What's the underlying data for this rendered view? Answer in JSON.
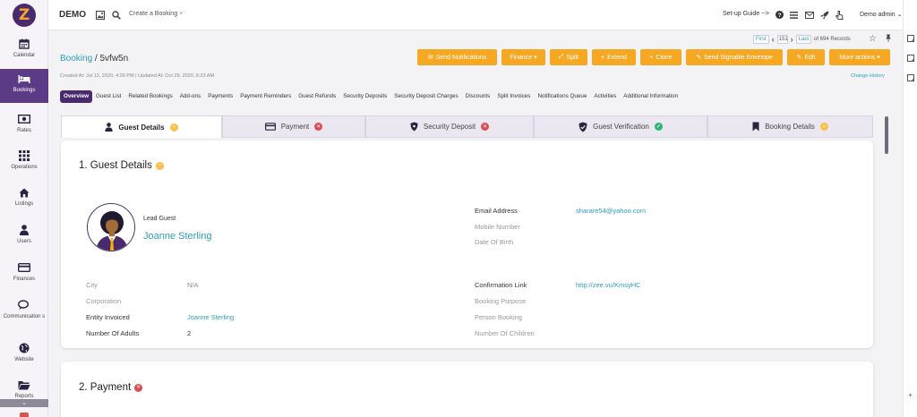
{
  "sidebar": {
    "logo": "Z",
    "items": [
      {
        "label": "Calendar",
        "icon": "calendar-icon"
      },
      {
        "label": "Bookings",
        "icon": "bed-icon"
      },
      {
        "label": "Rates",
        "icon": "money-icon"
      },
      {
        "label": "Operations",
        "icon": "grid-icon"
      },
      {
        "label": "Listings",
        "icon": "home-icon"
      },
      {
        "label": "Users",
        "icon": "user-icon"
      },
      {
        "label": "Finances",
        "icon": "credit-card-icon"
      },
      {
        "label": "Communication s",
        "icon": "chat-icon"
      },
      {
        "label": "Website",
        "icon": "globe-icon"
      },
      {
        "label": "Reports",
        "icon": "folder-icon"
      }
    ],
    "active": "Bookings",
    "scroll_glyph": "⌄"
  },
  "topbar": {
    "brand": "DEMO",
    "tab_label": "Create a Booking",
    "tab_close": "×",
    "setup_guide": "Set-up Guide -->",
    "user": "Demo admin",
    "user_caret": "⌄"
  },
  "pager": {
    "first": "First",
    "prev": "‹",
    "current": "151",
    "next": "›",
    "last": "Last",
    "total": "of 694 Records"
  },
  "breadcrumb": {
    "parent": "Booking",
    "separator": "/",
    "current": "5vfw5n"
  },
  "meta": "Created At: Jul 13, 2020, 4:06 PM  |  Updated At: Oct 29, 2020, 6:23 AM",
  "change_history": "Change History",
  "actions": [
    {
      "label": "Send Notifications",
      "icon": "✉"
    },
    {
      "label": "Finance ▾",
      "icon": ""
    },
    {
      "label": "Split",
      "icon": "⤢"
    },
    {
      "label": "Extend",
      "icon": "+"
    },
    {
      "label": "Clone",
      "icon": "+"
    },
    {
      "label": "Send Signable Envelope",
      "icon": "✎"
    },
    {
      "label": "Edit",
      "icon": "✎"
    },
    {
      "label": "More actions ▾",
      "icon": ""
    }
  ],
  "subtabs": [
    "Overview",
    "Guest List",
    "Related Bookings",
    "Add-ons",
    "Payments",
    "Payment Reminders",
    "Guest Refunds",
    "Security Deposits",
    "Security Deposit Charges",
    "Discounts",
    "Split Invoices",
    "Notifications Queue",
    "Activities",
    "Additional Information"
  ],
  "section_tabs": [
    {
      "label": "Guest Details",
      "status": "warn",
      "glyph": "−",
      "icon": "user-icon"
    },
    {
      "label": "Payment",
      "status": "err",
      "glyph": "×",
      "icon": "credit-card-icon"
    },
    {
      "label": "Security Deposit",
      "status": "err",
      "glyph": "×",
      "icon": "shield-icon"
    },
    {
      "label": "Guest Verification",
      "status": "ok",
      "glyph": "✓",
      "icon": "verified-shield-icon"
    },
    {
      "label": "Booking Details",
      "status": "warn",
      "glyph": "−",
      "icon": "bookmark-icon"
    }
  ],
  "guest": {
    "title": "1. Guest Details",
    "status_glyph": "−",
    "lead_label": "Lead Guest",
    "lead_name": "Joanne Sterling",
    "left_fields": [
      {
        "label": "City",
        "value": "N/A"
      },
      {
        "label": "Corporation",
        "value": ""
      },
      {
        "label": "Entity Invoiced",
        "value": "Joanne Sterling"
      },
      {
        "label": "Number Of Adults",
        "value": "2"
      }
    ],
    "right_top": [
      {
        "label": "Email Address",
        "value": "sharare54@yahoo.com"
      },
      {
        "label": "Mobile Number",
        "value": ""
      },
      {
        "label": "Date Of Birth",
        "value": ""
      }
    ],
    "right_bottom": [
      {
        "label": "Confirmation Link",
        "value": "http://zee.vu/KmsyHC"
      },
      {
        "label": "Booking Purpose",
        "value": ""
      },
      {
        "label": "Person Booking",
        "value": ""
      },
      {
        "label": "Number Of Children",
        "value": ""
      }
    ]
  },
  "payment": {
    "title": "2. Payment",
    "status_glyph": "×"
  },
  "right_rail_plus": "+",
  "colors": {
    "brand_purple": "#4a2a6e",
    "accent_orange": "#f7a823",
    "link_teal": "#2a9fb8"
  }
}
